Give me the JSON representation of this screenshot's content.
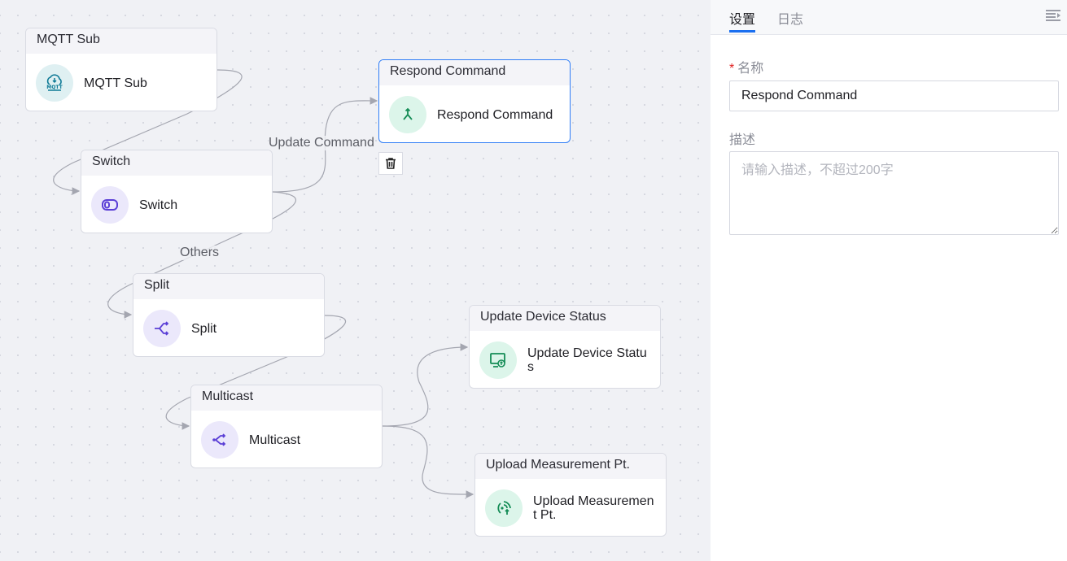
{
  "canvas": {
    "nodes": [
      {
        "id": "mqtt",
        "header": "MQTT Sub",
        "label": "MQTT Sub",
        "icon": "mqtt-cloud-icon",
        "icon_bg": "#dff0f2",
        "icon_color": "#0e7a96"
      },
      {
        "id": "respond",
        "header": "Respond Command",
        "label": "Respond Command",
        "icon": "merge-arrow-icon",
        "icon_bg": "#dcf5ea",
        "icon_color": "#148c56",
        "selected": true
      },
      {
        "id": "switch",
        "header": "Switch",
        "label": "Switch",
        "icon": "toggle-switch-icon",
        "icon_bg": "#ebe8fb",
        "icon_color": "#5b3fd6"
      },
      {
        "id": "split",
        "header": "Split",
        "label": "Split",
        "icon": "split-icon",
        "icon_bg": "#ebe8fb",
        "icon_color": "#5b3fd6"
      },
      {
        "id": "multicast",
        "header": "Multicast",
        "label": "Multicast",
        "icon": "multicast-icon",
        "icon_bg": "#ebe8fb",
        "icon_color": "#5b3fd6"
      },
      {
        "id": "update",
        "header": "Update Device Status",
        "label": "Update Device Status",
        "icon": "device-status-icon",
        "icon_bg": "#dcf5ea",
        "icon_color": "#148c56"
      },
      {
        "id": "upload",
        "header": "Upload Measurement Pt.",
        "label": "Upload Measurement Pt.",
        "icon": "upload-measurement-icon",
        "icon_bg": "#dcf5ea",
        "icon_color": "#148c56"
      }
    ],
    "edge_labels": {
      "update_command": "Update Command",
      "others": "Others"
    }
  },
  "panel": {
    "tabs": [
      {
        "label": "设置",
        "active": true
      },
      {
        "label": "日志",
        "active": false
      }
    ],
    "name_label": "名称",
    "required_mark": "*",
    "name_value": "Respond Command",
    "desc_label": "描述",
    "desc_placeholder": "请输入描述，不超过200字"
  }
}
